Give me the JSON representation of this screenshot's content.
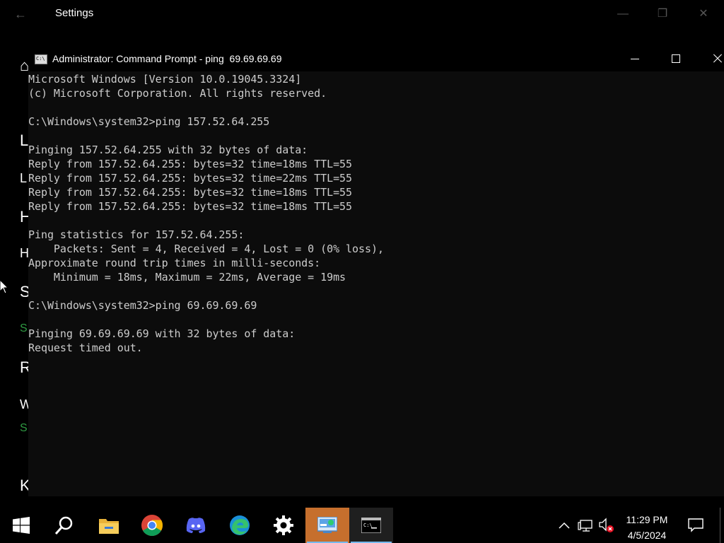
{
  "settings": {
    "title": "Settings",
    "peek_letters": [
      "⌂",
      "L",
      "L",
      "H",
      "H",
      "S",
      "S",
      "R",
      "W",
      "S",
      "K"
    ]
  },
  "cmd": {
    "title": "Administrator: Command Prompt - ping  69.69.69.69",
    "lines": [
      "Microsoft Windows [Version 10.0.19045.3324]",
      "(c) Microsoft Corporation. All rights reserved.",
      "",
      "C:\\Windows\\system32>ping 157.52.64.255",
      "",
      "Pinging 157.52.64.255 with 32 bytes of data:",
      "Reply from 157.52.64.255: bytes=32 time=18ms TTL=55",
      "Reply from 157.52.64.255: bytes=32 time=22ms TTL=55",
      "Reply from 157.52.64.255: bytes=32 time=18ms TTL=55",
      "Reply from 157.52.64.255: bytes=32 time=18ms TTL=55",
      "",
      "Ping statistics for 157.52.64.255:",
      "    Packets: Sent = 4, Received = 4, Lost = 0 (0% loss),",
      "Approximate round trip times in milli-seconds:",
      "    Minimum = 18ms, Maximum = 22ms, Average = 19ms",
      "",
      "C:\\Windows\\system32>ping 69.69.69.69",
      "",
      "Pinging 69.69.69.69 with 32 bytes of data:",
      "Request timed out."
    ]
  },
  "taskbar": {
    "apps": [
      {
        "name": "start-button",
        "icon": "windows-logo-icon"
      },
      {
        "name": "search-button",
        "icon": "search-icon"
      },
      {
        "name": "taskbar-file-explorer",
        "icon": "folder-icon"
      },
      {
        "name": "taskbar-chrome",
        "icon": "chrome-icon"
      },
      {
        "name": "taskbar-discord",
        "icon": "discord-icon"
      },
      {
        "name": "taskbar-edge",
        "icon": "edge-icon"
      },
      {
        "name": "taskbar-settings",
        "icon": "gear-icon"
      },
      {
        "name": "taskbar-control-panel",
        "icon": "control-panel-icon"
      },
      {
        "name": "taskbar-command-prompt",
        "icon": "command-prompt-icon"
      }
    ],
    "time": "11:29 PM",
    "date": "4/5/2024"
  },
  "colors": {
    "accent_active": "#c66f2d",
    "running_indicator": "#76b9ed",
    "console_text": "#cccccc",
    "console_bg": "#0c0c0c"
  }
}
